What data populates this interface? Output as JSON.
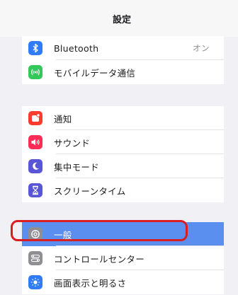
{
  "header": {
    "title": "設定"
  },
  "group1": [
    {
      "label": "Bluetooth",
      "value": "オン",
      "icon": "bluetooth-icon",
      "color": "#2f7cf6"
    },
    {
      "label": "モバイルデータ通信",
      "icon": "cellular-antenna-icon",
      "color": "#34c759"
    }
  ],
  "group2": [
    {
      "label": "通知",
      "icon": "notification-icon",
      "color": "#ff3b30"
    },
    {
      "label": "サウンド",
      "icon": "speaker-icon",
      "color": "#ff2d55"
    },
    {
      "label": "集中モード",
      "icon": "moon-icon",
      "color": "#5856d6"
    },
    {
      "label": "スクリーンタイム",
      "icon": "hourglass-icon",
      "color": "#5856d6"
    }
  ],
  "group3": [
    {
      "label": "一般",
      "icon": "gear-icon",
      "color": "#8e8e93",
      "selected": true
    },
    {
      "label": "コントロールセンター",
      "icon": "toggle-switches-icon",
      "color": "#8e8e93"
    },
    {
      "label": "画面表示と明るさ",
      "icon": "brightness-icon",
      "color": "#2f7cf6"
    }
  ],
  "colors": {
    "selection": "#5a8ff0",
    "highlight_ring": "#d81e22"
  }
}
